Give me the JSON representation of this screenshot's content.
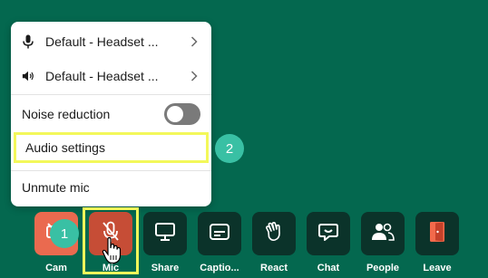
{
  "menu": {
    "mic_device": "Default - Headset ...",
    "speaker_device": "Default - Headset ...",
    "noise_reduction": "Noise reduction",
    "noise_reduction_on": false,
    "audio_settings": "Audio settings",
    "unmute": "Unmute mic"
  },
  "badges": {
    "step1": "1",
    "step2": "2"
  },
  "toolbar": {
    "cam": "Cam",
    "mic": "Mic",
    "share": "Share",
    "captions": "Captio...",
    "react": "React",
    "chat": "Chat",
    "people": "People",
    "leave": "Leave"
  },
  "colors": {
    "background": "#04684f",
    "highlight": "#f3f85a",
    "badge": "#39c0a4",
    "cam_off": "#ea6a4f",
    "mic_muted": "#c64d36",
    "tool_dark": "#0b332a"
  }
}
